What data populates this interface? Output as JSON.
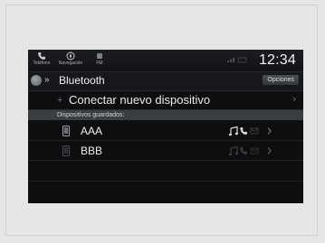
{
  "status_bar": {
    "phone_label": "Teléfono",
    "nav_label": "Navegación",
    "fm_label": "FM",
    "clock": "12:34"
  },
  "title_bar": {
    "title": "Bluetooth",
    "options_label": "Opciones"
  },
  "list": {
    "connect_label": "Conectar nuevo dispositivo",
    "saved_header": "Dispositivos guardados:",
    "devices": [
      {
        "name": "AAA",
        "active": true
      },
      {
        "name": "BBB",
        "active": false
      }
    ]
  },
  "colors": {
    "screen_bg": "#0e0e10",
    "section_header_bg": "#3a3d42",
    "text_primary": "#eceef0"
  }
}
